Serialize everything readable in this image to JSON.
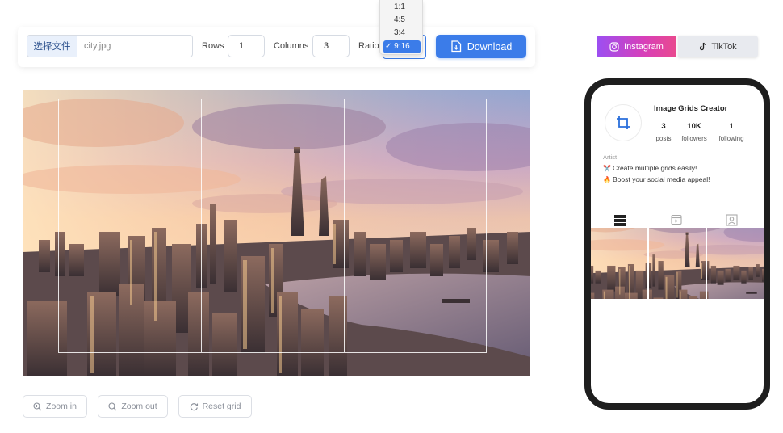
{
  "toolbar": {
    "file_button": "选择文件",
    "file_name": "city.jpg",
    "rows_label": "Rows",
    "rows_value": "1",
    "columns_label": "Columns",
    "columns_value": "3",
    "ratio_label": "Ratio",
    "download_label": "Download"
  },
  "ratio_dropdown": {
    "options": [
      "1:1",
      "4:5",
      "3:4",
      "9:16"
    ],
    "selected": "9:16",
    "check_glyph": "✓"
  },
  "controls": {
    "zoom_in": "Zoom in",
    "zoom_out": "Zoom out",
    "reset_grid": "Reset grid"
  },
  "platforms": {
    "instagram": "Instagram",
    "tiktok": "TikTok"
  },
  "profile": {
    "name": "Image Grids Creator",
    "stats": [
      {
        "value": "3",
        "label": "posts"
      },
      {
        "value": "10K",
        "label": "followers"
      },
      {
        "value": "1",
        "label": "following"
      }
    ],
    "category": "Artist",
    "bio": [
      {
        "icon": "✂️",
        "text": "Create multiple grids easily!"
      },
      {
        "icon": "🔥",
        "text": "Boost your social media appeal!"
      }
    ]
  },
  "colors": {
    "accent": "#3b7ce9",
    "instagram_gradient_start": "#9b4ff2",
    "instagram_gradient_end": "#e94a8e",
    "phone_frame": "#1e1e1e"
  }
}
